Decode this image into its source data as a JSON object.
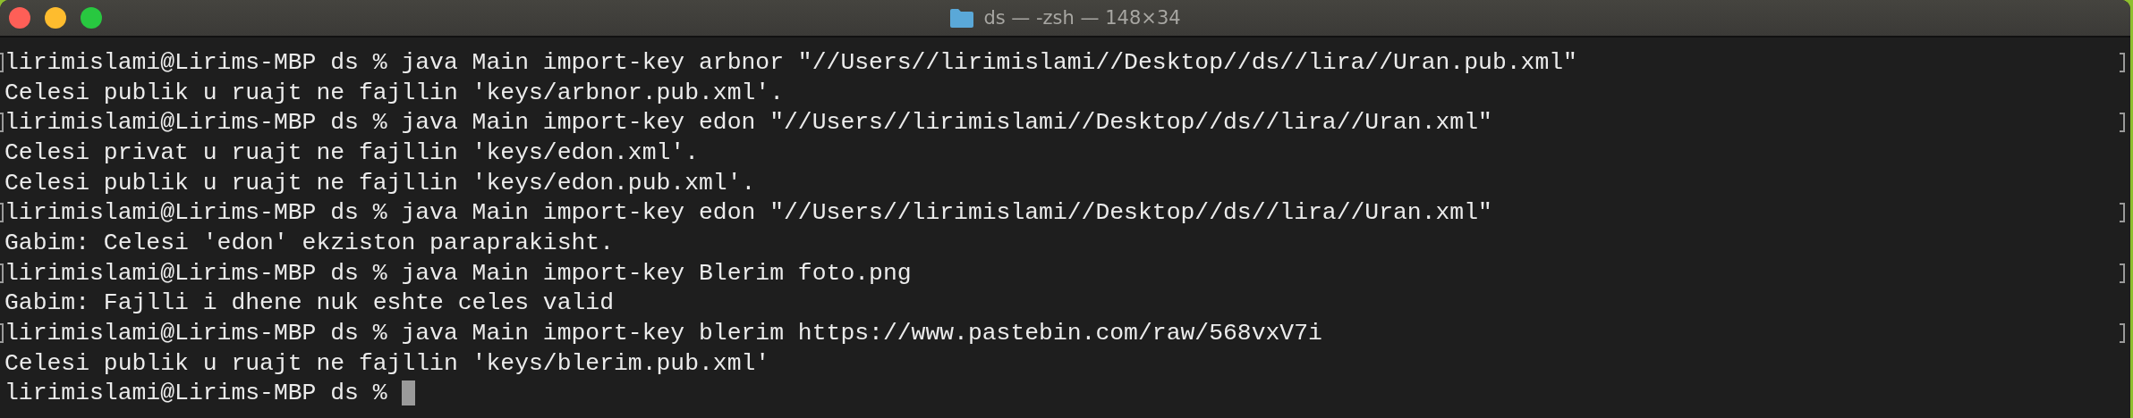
{
  "window": {
    "title": "ds — -zsh — 148×34"
  },
  "lines": [
    {
      "kind": "prompt",
      "text": "lirimislami@Lirims-MBP ds % java Main import-key arbnor \"//Users//lirimislami//Desktop//ds//lira//Uran.pub.xml\""
    },
    {
      "kind": "output",
      "text": "Celesi publik u ruajt ne fajllin 'keys/arbnor.pub.xml'."
    },
    {
      "kind": "prompt",
      "text": "lirimislami@Lirims-MBP ds % java Main import-key edon \"//Users//lirimislami//Desktop//ds//lira//Uran.xml\""
    },
    {
      "kind": "output",
      "text": "Celesi privat u ruajt ne fajllin 'keys/edon.xml'."
    },
    {
      "kind": "output",
      "text": "Celesi publik u ruajt ne fajllin 'keys/edon.pub.xml'."
    },
    {
      "kind": "prompt",
      "text": "lirimislami@Lirims-MBP ds % java Main import-key edon \"//Users//lirimislami//Desktop//ds//lira//Uran.xml\""
    },
    {
      "kind": "output",
      "text": "Gabim: Celesi 'edon' ekziston paraprakisht."
    },
    {
      "kind": "prompt",
      "text": "lirimislami@Lirims-MBP ds % java Main import-key Blerim foto.png"
    },
    {
      "kind": "output",
      "text": "Gabim: Fajlli i dhene nuk eshte celes valid"
    },
    {
      "kind": "prompt",
      "text": "lirimislami@Lirims-MBP ds % java Main import-key blerim https://www.pastebin.com/raw/568vxV7i"
    },
    {
      "kind": "output",
      "text": "Celesi publik u ruajt ne fajllin 'keys/blerim.pub.xml'"
    },
    {
      "kind": "input",
      "text": "lirimislami@Lirims-MBP ds %"
    }
  ]
}
